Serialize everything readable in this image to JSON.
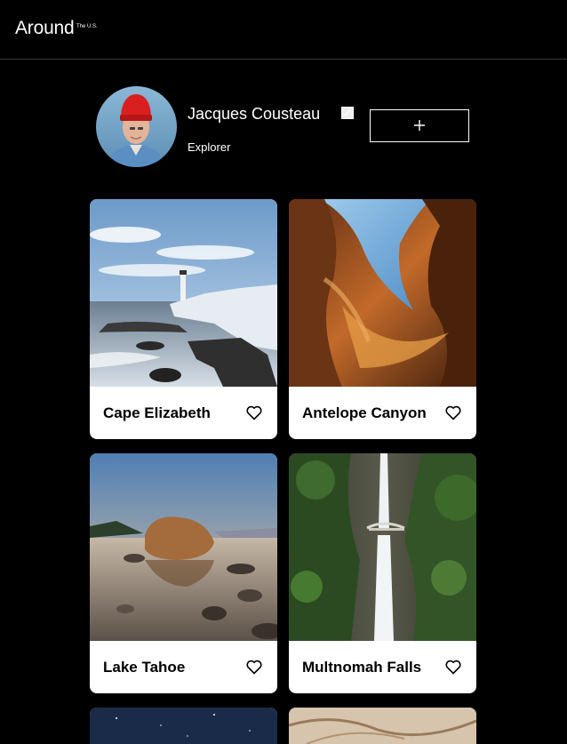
{
  "header": {
    "logo": "Around",
    "logo_sup": "The U.S."
  },
  "profile": {
    "name": "Jacques Cousteau",
    "job": "Explorer",
    "edit_icon": "edit-icon",
    "add_icon": "plus-icon"
  },
  "cards": [
    {
      "title": "Cape Elizabeth",
      "like_icon": "heart-icon"
    },
    {
      "title": "Antelope Canyon",
      "like_icon": "heart-icon"
    },
    {
      "title": "Lake Tahoe",
      "like_icon": "heart-icon"
    },
    {
      "title": "Multnomah Falls",
      "like_icon": "heart-icon"
    }
  ],
  "colors": {
    "background": "#000000",
    "card": "#ffffff",
    "text_light": "#ffffff",
    "text_dark": "#000000",
    "divider": "#3a3a3a"
  }
}
